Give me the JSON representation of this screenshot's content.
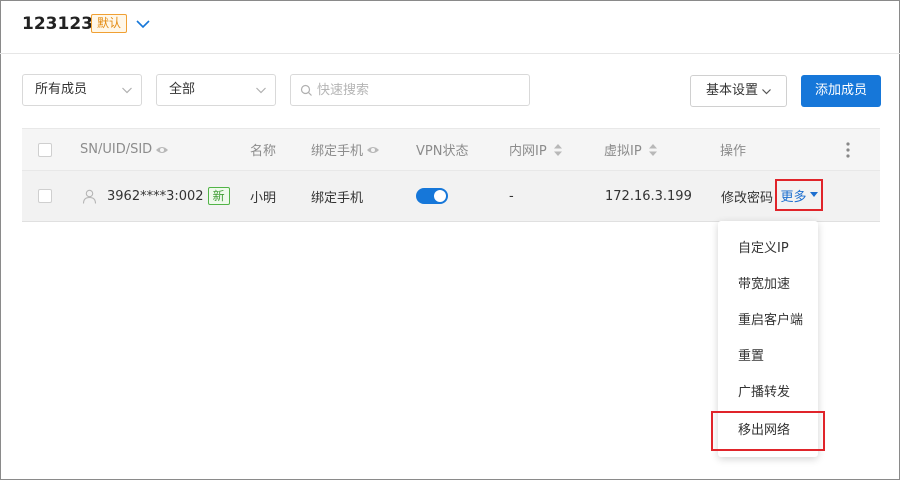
{
  "header": {
    "title": "123123",
    "default_badge": "默认"
  },
  "toolbar": {
    "member_filter": "所有成员",
    "status_filter": "全部",
    "search_placeholder": "快速搜索",
    "settings_label": "基本设置",
    "add_member_label": "添加成员"
  },
  "table": {
    "columns": {
      "sn": "SN/UID/SID",
      "name": "名称",
      "phone": "绑定手机",
      "vpn": "VPN状态",
      "lan_ip": "内网IP",
      "virtual_ip": "虚拟IP",
      "actions": "操作"
    },
    "rows": [
      {
        "sn": "3962****3:002",
        "new_badge": "新",
        "name": "小明",
        "phone": "绑定手机",
        "vpn_enabled": true,
        "lan_ip": "-",
        "virtual_ip": "172.16.3.199",
        "action_edit": "修改密码",
        "action_more": "更多"
      }
    ]
  },
  "more_menu": {
    "items": [
      "自定义IP",
      "带宽加速",
      "重启客户端",
      "重置",
      "广播转发",
      "移出网络"
    ]
  },
  "colors": {
    "primary": "#1677d9",
    "link": "#1d6fcf",
    "highlight": "#e0242a",
    "badge_default": "#e38b12",
    "badge_new": "#3e9c33"
  }
}
